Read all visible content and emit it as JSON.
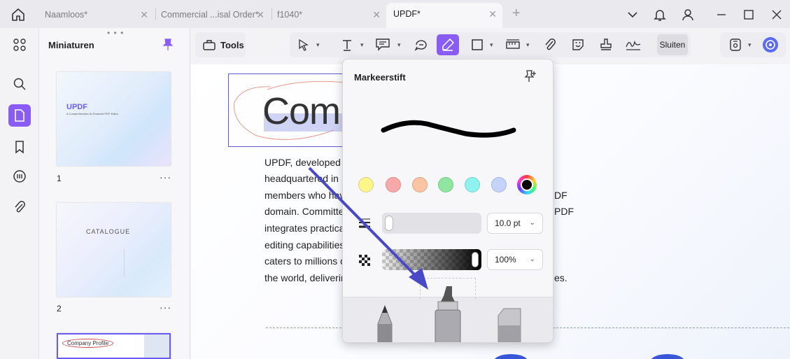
{
  "tabs": [
    {
      "label": "Naamloos*"
    },
    {
      "label": "Commercial ...isal Order*"
    },
    {
      "label": "f1040*"
    },
    {
      "label": "UPDF*"
    }
  ],
  "thumbnails": {
    "title": "Miniaturen",
    "pages": [
      {
        "number": "1",
        "title": "UPDF",
        "subtitle": "A Comprehensive AI-Powered PDF Editor"
      },
      {
        "number": "2",
        "title": "CATALOGUE"
      },
      {
        "number": "3",
        "title": "Company Profile"
      }
    ]
  },
  "toolbar": {
    "tools_label": "Tools",
    "close_label": "Sluiten"
  },
  "document": {
    "heading": "Comp",
    "lines": [
      "UPDF, developed b",
      "headquartered in",
      "members who hav",
      "domain. Committe",
      "integrates practica",
      "editing capabilities",
      "caters to millions o",
      "the world, deliverin"
    ],
    "right_fragments": [
      "DF",
      "PDF",
      "es."
    ]
  },
  "popup": {
    "title": "Markeerstift",
    "colors": [
      "#fbf58a",
      "#f8a8a8",
      "#f9c4a2",
      "#8fe6a0",
      "#8ef2ee",
      "#c4d3fb",
      "#000000"
    ],
    "thickness": "10.0 pt",
    "opacity": "100%",
    "accent": "#8a5cf6"
  }
}
